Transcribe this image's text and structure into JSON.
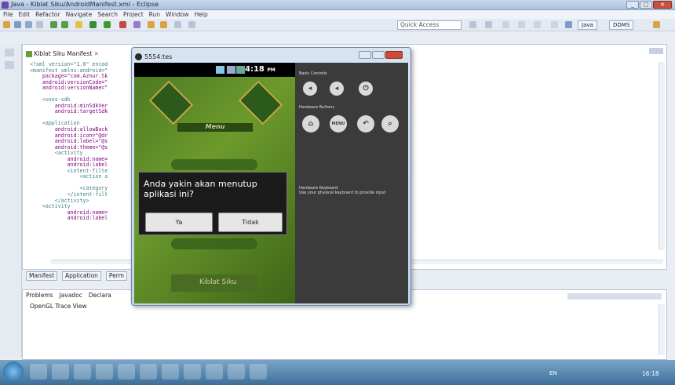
{
  "window": {
    "title": "Java - Kiblat Siku/AndroidManifest.xml - Eclipse"
  },
  "menu": [
    "File",
    "Edit",
    "Refactor",
    "Navigate",
    "Search",
    "Project",
    "Run",
    "Window",
    "Help"
  ],
  "toolbar": {
    "quick_access": "Quick Access",
    "persp_java": "Java",
    "persp_ddms": "DDMS"
  },
  "editor": {
    "tab": "Kiblat Siku Manifest",
    "code": [
      "<?xml version=\"1.0\" encod",
      "<manifest xmlns:android=\"",
      "    package=\"com.Aznur.Sk",
      "    android:versionCode=\"",
      "    android:versionName=\"",
      "",
      "    <uses-sdk",
      "        android:minSdkVer",
      "        android:targetSdk",
      "",
      "    <application",
      "        android:allowBack",
      "        android:icon=\"@dr",
      "        android:label=\"@s",
      "        android:theme=\"@s",
      "        <activity",
      "            android:name=",
      "            android:label",
      "            <intent-filte",
      "                <action a",
      "",
      "                <category",
      "            </intent-filt",
      "        </activity>",
      "    <activity",
      "            android:name=",
      "            android:label"
    ],
    "bottom_tabs": [
      "Manifest",
      "Application",
      "Perm"
    ]
  },
  "views": {
    "tabs": [
      "Problems",
      "Javadoc",
      "Declara"
    ],
    "content": "OpenGL Trace View"
  },
  "emulator": {
    "title": "5554:tes",
    "clock": "4:18",
    "ampm": "PM",
    "menu_label": "Menu",
    "dialog_message": "Anda yakin akan menutup aplikasi ini?",
    "btn_yes": "Ya",
    "btn_no": "Tidak",
    "basic_controls": "Basic Controls",
    "hardware_buttons": "Hardware Buttons",
    "hw_keyboard": "Hardware Keyboard",
    "hw_keyboard_desc": "Use your physical keyboard to provide input",
    "menu_btn": "MENU",
    "app_name_bottom": "Kiblat Siku"
  },
  "taskbar": {
    "lang": "EN",
    "time": "16:18"
  }
}
